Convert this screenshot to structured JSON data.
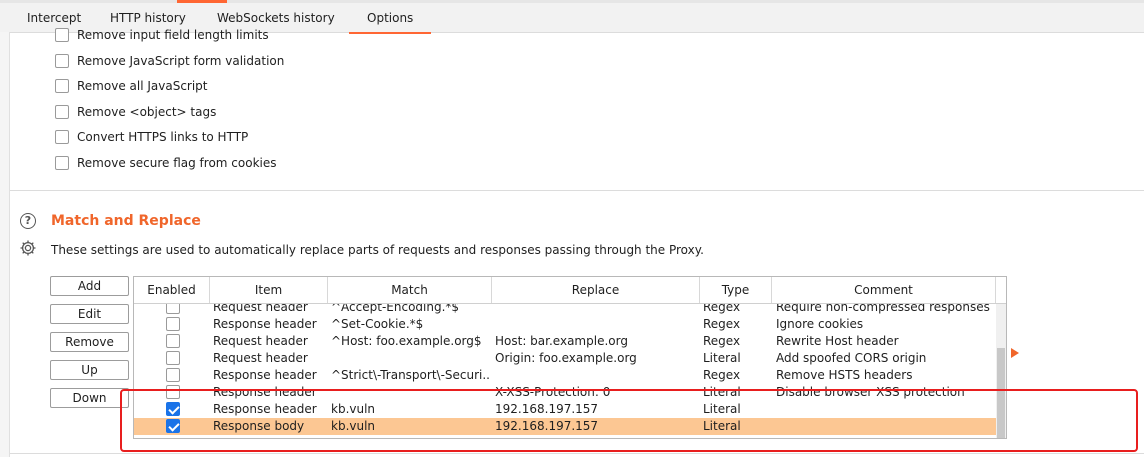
{
  "tabs": [
    "Intercept",
    "HTTP history",
    "WebSockets history",
    "Options"
  ],
  "options": [
    "Remove input field length limits",
    "Remove JavaScript form validation",
    "Remove all JavaScript",
    "Remove <object> tags",
    "Convert HTTPS links to HTTP",
    "Remove secure flag from cookies"
  ],
  "section": {
    "title": "Match and Replace",
    "description": "These settings are used to automatically replace parts of requests and responses passing through the Proxy."
  },
  "buttons": [
    "Add",
    "Edit",
    "Remove",
    "Up",
    "Down"
  ],
  "table": {
    "columns": [
      "Enabled",
      "Item",
      "Match",
      "Replace",
      "Type",
      "Comment"
    ],
    "rows": [
      {
        "enabled": false,
        "item": "Request header",
        "match": "^Accept-Encoding.*$",
        "replace": "",
        "type": "Regex",
        "comment": "Require non-compressed responses"
      },
      {
        "enabled": false,
        "item": "Response header",
        "match": "^Set-Cookie.*$",
        "replace": "",
        "type": "Regex",
        "comment": "Ignore cookies"
      },
      {
        "enabled": false,
        "item": "Request header",
        "match": "^Host: foo.example.org$",
        "replace": "Host: bar.example.org",
        "type": "Regex",
        "comment": "Rewrite Host header"
      },
      {
        "enabled": false,
        "item": "Request header",
        "match": "",
        "replace": "Origin: foo.example.org",
        "type": "Literal",
        "comment": "Add spoofed CORS origin"
      },
      {
        "enabled": false,
        "item": "Response header",
        "match": "^Strict\\-Transport\\-Securi...",
        "replace": "",
        "type": "Regex",
        "comment": "Remove HSTS headers"
      },
      {
        "enabled": false,
        "item": "Response header",
        "match": "",
        "replace": "X-XSS-Protection: 0",
        "type": "Literal",
        "comment": "Disable browser XSS protection"
      },
      {
        "enabled": true,
        "item": "Response header",
        "match": "kb.vuln",
        "replace": "192.168.197.157",
        "type": "Literal",
        "comment": ""
      },
      {
        "enabled": true,
        "item": "Response body",
        "match": "kb.vuln",
        "replace": "192.168.197.157",
        "type": "Literal",
        "comment": "",
        "selected": true
      }
    ]
  },
  "colors": {
    "accent": "#f0662b",
    "selected_row": "#fcc793",
    "annotation": "#e81e1e",
    "checkbox_on": "#1a73e8"
  },
  "icons": [
    "help-icon",
    "gear-icon",
    "expand-arrow-icon"
  ]
}
